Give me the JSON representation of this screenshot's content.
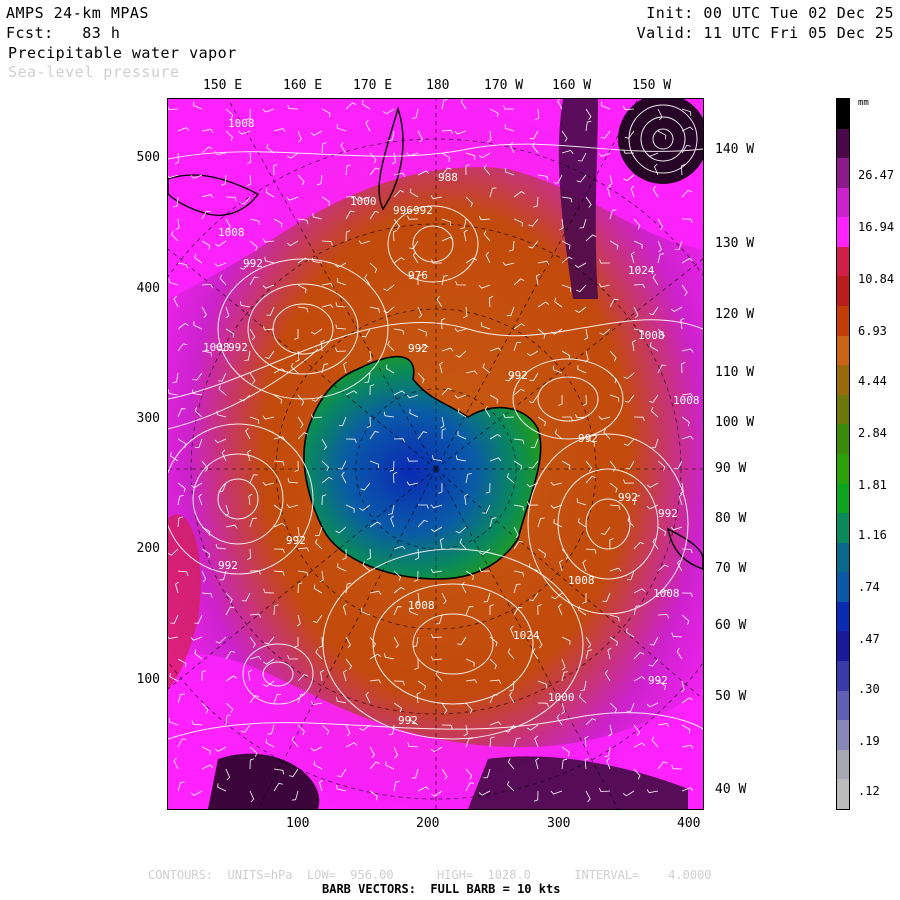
{
  "header": {
    "model": "AMPS 24-km MPAS",
    "forecast": "Fcst:   83 h",
    "field1": "Precipitable water vapor",
    "field2": "Sea-level pressure",
    "init": "Init: 00 UTC Tue 02 Dec 25",
    "valid": "Valid: 11 UTC Fri 05 Dec 25"
  },
  "top_longitudes": [
    "150 E",
    "160 E",
    "170 E",
    "180",
    "170 W",
    "160 W",
    "150 W"
  ],
  "right_longitudes": [
    "140 W",
    "130 W",
    "120 W",
    "110 W",
    "100 W",
    "90 W",
    "80 W",
    "70 W",
    "60 W",
    "50 W",
    "40 W"
  ],
  "y_ticks": [
    "500",
    "400",
    "300",
    "200",
    "100"
  ],
  "x_ticks": [
    "100",
    "200",
    "300",
    "400"
  ],
  "colorbar": {
    "units": "mm",
    "colors": [
      "#000000",
      "#4a0a4a",
      "#8b1a8b",
      "#cc22cc",
      "#ff22ff",
      "#d21f4a",
      "#b81e1e",
      "#c23c08",
      "#c86414",
      "#9a6a0a",
      "#6e780a",
      "#3c8a0a",
      "#2aa00a",
      "#0aa41e",
      "#0a8a5a",
      "#0a6a8c",
      "#0a5aa8",
      "#0a2ab4",
      "#1a1a9a",
      "#3a3aa8",
      "#6060b4",
      "#8888b8",
      "#a8a8b4",
      "#bcbcbc"
    ],
    "labels": [
      "26.47",
      "16.94",
      "10.84",
      "6.93",
      "4.44",
      "2.84",
      "1.81",
      "1.16",
      ".74",
      ".47",
      ".30",
      ".19",
      ".12"
    ]
  },
  "isobar_labels": [
    "1008",
    "1008",
    "1000",
    "996",
    "992",
    "992",
    "988",
    "976",
    "1024",
    "1008",
    "992",
    "992",
    "1008",
    "992",
    "992",
    "1008",
    "992",
    "992",
    "992",
    "992",
    "1008",
    "1008",
    "1008",
    "1024",
    "1000",
    "992",
    "992"
  ],
  "footer": {
    "contours": "CONTOURS:  UNITS=hPa  LOW=  956.00      HIGH=  1028.0      INTERVAL=    4.0000",
    "barbs": "BARB VECTORS:  FULL BARB = 10 kts"
  }
}
